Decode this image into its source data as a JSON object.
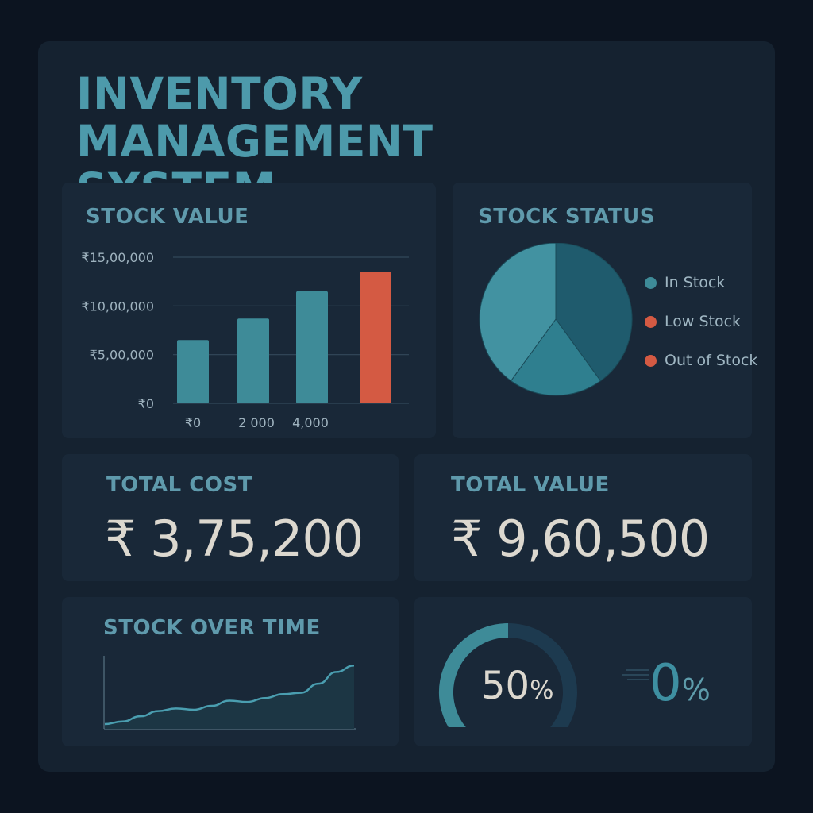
{
  "header": {
    "title_line1": "INVENTORY MANAGEMENT",
    "title_line2": "SYSTEM"
  },
  "stock_value": {
    "title": "STOCK VALUE",
    "chart_data": {
      "type": "bar",
      "y_tick_labels": [
        "₹15,00,000",
        "₹10,00,000",
        "₹5,00,000",
        "₹0"
      ],
      "y_ticks": [
        1500000,
        1000000,
        500000,
        0
      ],
      "ylim": [
        0,
        1500000
      ],
      "x_tick_labels": [
        "₹0",
        "2 000",
        "4,000"
      ],
      "values": [
        650000,
        870000,
        1150000,
        1350000
      ],
      "bar_colors": [
        "#3e8b98",
        "#3e8b98",
        "#3e8b98",
        "#d45a43"
      ],
      "grid": true
    }
  },
  "stock_status": {
    "title": "STOCK STATUS",
    "chart_data": {
      "type": "pie",
      "slices": [
        {
          "value": 40,
          "color": "#1f5b6d"
        },
        {
          "value": 20,
          "color": "#2f7f8f"
        },
        {
          "value": 40,
          "color": "#4292a1"
        }
      ]
    },
    "legend": [
      {
        "label": "In Stock",
        "color": "#3e8b98"
      },
      {
        "label": "Low Stock",
        "color": "#d45a43"
      },
      {
        "label": "Out of Stock",
        "color": "#d45a43"
      }
    ]
  },
  "total_cost": {
    "title": "TOTAL COST",
    "value": "₹ 3,75,200"
  },
  "total_value": {
    "title": "TOTAL VALUE",
    "value": "₹ 9,60,500"
  },
  "stock_over_time": {
    "title": "STOCK OVER TIME",
    "chart_data": {
      "type": "area",
      "values": [
        0,
        4,
        12,
        20,
        24,
        22,
        28,
        36,
        34,
        40,
        46,
        48,
        62,
        80,
        90
      ]
    }
  },
  "gauge": {
    "value_number": "50",
    "value_unit": "%",
    "fraction": 0.5
  },
  "percent_stat": {
    "number": "0",
    "unit": "%"
  },
  "colors": {
    "accent": "#4d9aab",
    "alert": "#d45a43",
    "panel": "#192838",
    "background": "#0c1420"
  }
}
